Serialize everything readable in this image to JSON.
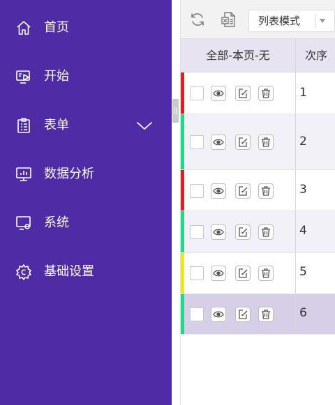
{
  "sidebar": {
    "items": [
      {
        "label": "首页",
        "icon": "home-icon"
      },
      {
        "label": "开始",
        "icon": "play-screen-icon"
      },
      {
        "label": "表单",
        "icon": "clipboard-list-icon",
        "expand_icon": "chevron-down-icon"
      },
      {
        "label": "数据分析",
        "icon": "monitor-chart-icon"
      },
      {
        "label": "系统",
        "icon": "monitor-settings-icon"
      },
      {
        "label": "基础设置",
        "icon": "gear-icon"
      }
    ]
  },
  "toolbar": {
    "refresh_icon": "refresh-icon",
    "export_icon": "excel-export-icon",
    "view_mode": "列表模式"
  },
  "table": {
    "columns": [
      "全部-本页-无",
      "次序"
    ],
    "rows": [
      {
        "order": "1",
        "status_color": "#e02020"
      },
      {
        "order": "2",
        "status_color": "#1ed98a"
      },
      {
        "order": "3",
        "status_color": "#e02020"
      },
      {
        "order": "4",
        "status_color": "#1ed98a"
      },
      {
        "order": "5",
        "status_color": "#f2e425"
      },
      {
        "order": "6",
        "status_color": "#1ed98a"
      }
    ],
    "row_actions": [
      "view-icon",
      "edit-icon",
      "delete-icon"
    ]
  },
  "colors": {
    "sidebar_bg": "#4f2ba6",
    "header_bg": "#e8e3f0",
    "selected_row_bg": "#d7cfe8"
  }
}
